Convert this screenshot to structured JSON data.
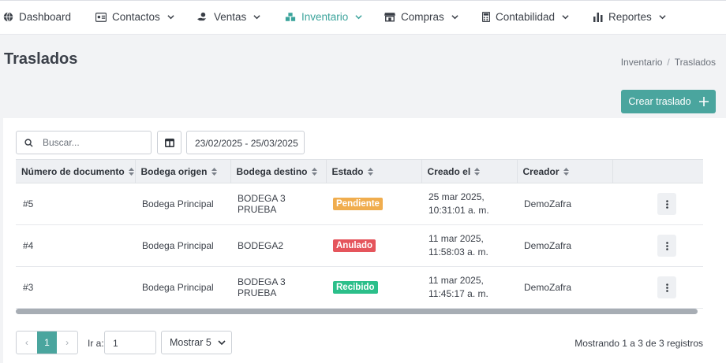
{
  "nav": [
    {
      "id": "dashboard",
      "label": "Dashboard",
      "icon": "globe-icon",
      "dropdown": false
    },
    {
      "id": "contactos",
      "label": "Contactos",
      "icon": "contact-card-icon",
      "dropdown": true
    },
    {
      "id": "ventas",
      "label": "Ventas",
      "icon": "hand-coin-icon",
      "dropdown": true
    },
    {
      "id": "inventario",
      "label": "Inventario",
      "icon": "boxes-icon",
      "dropdown": true,
      "active": true
    },
    {
      "id": "compras",
      "label": "Compras",
      "icon": "store-icon",
      "dropdown": true
    },
    {
      "id": "contabilidad",
      "label": "Contabilidad",
      "icon": "calculator-icon",
      "dropdown": true
    },
    {
      "id": "reportes",
      "label": "Reportes",
      "icon": "bar-chart-icon",
      "dropdown": true
    }
  ],
  "page": {
    "title": "Traslados",
    "breadcrumb": [
      "Inventario",
      "Traslados"
    ],
    "create_label": "Crear traslado"
  },
  "filters": {
    "search_placeholder": "Buscar...",
    "date_range": "23/02/2025  - 25/03/2025"
  },
  "table": {
    "columns": [
      "Número de documento",
      "Bodega origen",
      "Bodega destino",
      "Estado",
      "Creado el",
      "Creador"
    ],
    "rows": [
      {
        "doc": "#5",
        "origen": "Bodega Principal",
        "destino": "BODEGA 3 PRUEBA",
        "estado": "Pendiente",
        "estado_type": "pendiente",
        "creado": "25 mar 2025, 10:31:01 a. m.",
        "creador": "DemoZafra"
      },
      {
        "doc": "#4",
        "origen": "Bodega Principal",
        "destino": "BODEGA2",
        "estado": "Anulado",
        "estado_type": "anulado",
        "creado": "11 mar 2025, 11:58:03 a. m.",
        "creador": "DemoZafra"
      },
      {
        "doc": "#3",
        "origen": "Bodega Principal",
        "destino": "BODEGA 3 PRUEBA",
        "estado": "Recibido",
        "estado_type": "recibido",
        "creado": "11 mar 2025, 11:45:17 a. m.",
        "creador": "DemoZafra"
      }
    ]
  },
  "pagination": {
    "prev": "‹",
    "current_page": "1",
    "next": "›",
    "goto_label": "Ir a:",
    "goto_value": "1",
    "show_label": "Mostrar 5",
    "summary": "Mostrando 1 a 3 de 3 registros"
  },
  "colors": {
    "accent": "#4aa59e",
    "nav_active": "#3aa39b",
    "pendiente": "#f0ad4e",
    "anulado": "#e5555c",
    "recibido": "#2bbf8a"
  }
}
